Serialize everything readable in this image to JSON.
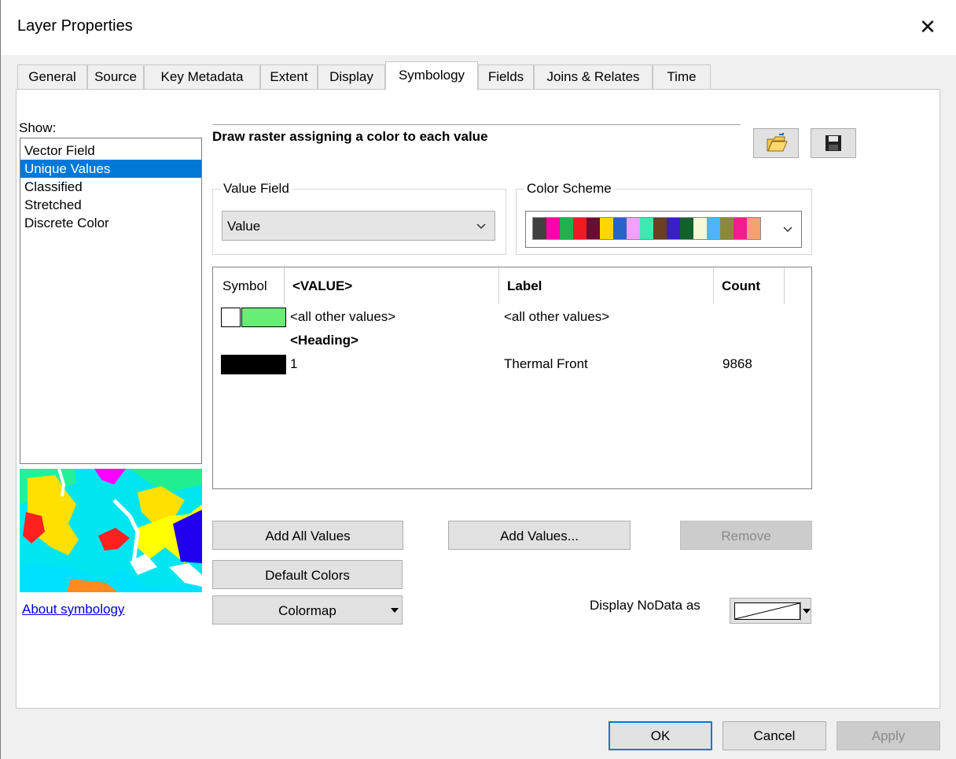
{
  "window": {
    "title": "Layer Properties"
  },
  "tabs": [
    {
      "label": "General"
    },
    {
      "label": "Source"
    },
    {
      "label": "Key Metadata"
    },
    {
      "label": "Extent"
    },
    {
      "label": "Display"
    },
    {
      "label": "Symbology",
      "active": true
    },
    {
      "label": "Fields"
    },
    {
      "label": "Joins & Relates"
    },
    {
      "label": "Time"
    }
  ],
  "show": {
    "label": "Show:",
    "items": [
      "Vector Field",
      "Unique Values",
      "Classified",
      "Stretched",
      "Discrete Color"
    ],
    "selected": "Unique Values"
  },
  "about_link": "About symbology",
  "heading": "Draw raster assigning a color to each value",
  "value_field": {
    "label": "Value Field",
    "value": "Value"
  },
  "color_scheme": {
    "label": "Color Scheme",
    "colors": [
      "#404040",
      "#ff00aa",
      "#22b14c",
      "#ed1c24",
      "#6a0d33",
      "#ffd700",
      "#2864c8",
      "#f0a0ff",
      "#3ee8b0",
      "#6b3f1f",
      "#3a1ec8",
      "#12602a",
      "#f6f8d6",
      "#4fb4ff",
      "#8a8a3a",
      "#f01e8c",
      "#f4a070"
    ]
  },
  "symbol_table": {
    "headers": {
      "symbol": "Symbol",
      "value": "<VALUE>",
      "label": "Label",
      "count": "Count"
    },
    "other": {
      "value": "<all other values>",
      "label": "<all other values>",
      "color": "#66ee77"
    },
    "heading_row": "<Heading>",
    "rows": [
      {
        "value": "1",
        "label": "Thermal Front",
        "count": "9868",
        "color": "#000000"
      }
    ]
  },
  "buttons": {
    "add_all": "Add All Values",
    "add_values": "Add Values...",
    "remove": "Remove",
    "default_colors": "Default Colors",
    "colormap": "Colormap"
  },
  "nodata_label": "Display NoData as",
  "footer": {
    "ok": "OK",
    "cancel": "Cancel",
    "apply": "Apply"
  }
}
